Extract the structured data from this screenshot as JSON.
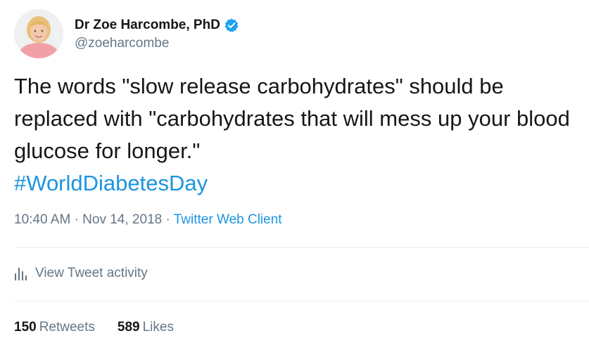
{
  "user": {
    "display_name": "Dr Zoe Harcombe, PhD",
    "handle": "@zoeharcombe",
    "verified_icon": "verified-badge-icon"
  },
  "tweet": {
    "text": "The words \"slow release carbohydrates\" should be replaced with \"carbohydrates that will mess up your blood glucose for longer.\"",
    "hashtag": "#WorldDiabetesDay",
    "time": "10:40 AM",
    "separator": "·",
    "date": "Nov 14, 2018",
    "client": "Twitter Web Client"
  },
  "activity": {
    "icon": "bar-chart-icon",
    "label": "View Tweet activity"
  },
  "stats": {
    "retweets_count": "150",
    "retweets_label": "Retweets",
    "likes_count": "589",
    "likes_label": "Likes"
  },
  "colors": {
    "text": "#14171a",
    "secondary": "#657786",
    "link": "#1b95e0",
    "verified": "#1da1f2",
    "divider": "#e6ecf0"
  }
}
